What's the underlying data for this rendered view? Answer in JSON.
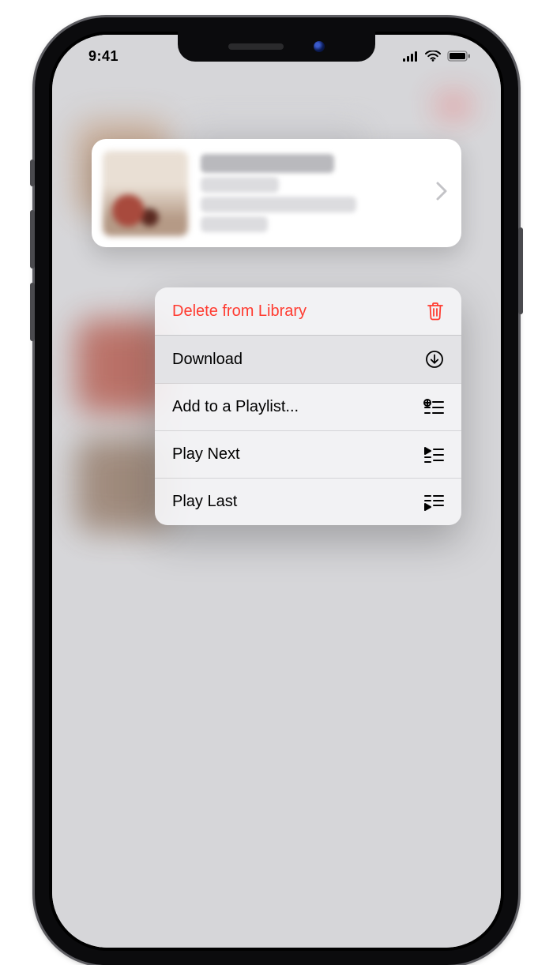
{
  "statusbar": {
    "time": "9:41"
  },
  "preview": {
    "title": "",
    "subtitle1": "",
    "subtitle2": "",
    "subtitle3": ""
  },
  "menu": {
    "items": [
      {
        "label": "Delete from Library",
        "icon": "trash",
        "destructive": true,
        "highlighted": false
      },
      {
        "label": "Download",
        "icon": "download-circle",
        "destructive": false,
        "highlighted": true
      },
      {
        "label": "Add to a Playlist...",
        "icon": "add-playlist",
        "destructive": false,
        "highlighted": false
      },
      {
        "label": "Play Next",
        "icon": "play-next",
        "destructive": false,
        "highlighted": false
      },
      {
        "label": "Play Last",
        "icon": "play-last",
        "destructive": false,
        "highlighted": false
      }
    ]
  },
  "colors": {
    "destructive": "#ff3b30"
  }
}
